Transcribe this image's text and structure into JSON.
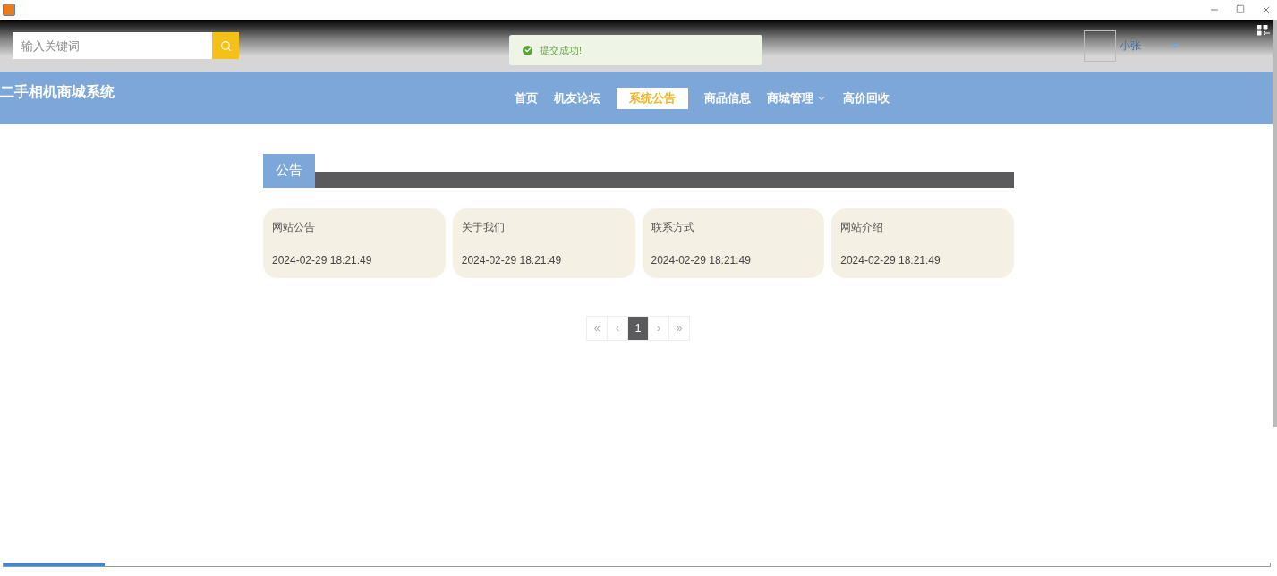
{
  "search": {
    "placeholder": "输入关键词"
  },
  "toast": {
    "message": "提交成功!"
  },
  "user": {
    "name": "小张"
  },
  "site_title": "二手相机商城系统",
  "nav": [
    {
      "label": "首页",
      "selected": false,
      "dropdown": false
    },
    {
      "label": "机友论坛",
      "selected": false,
      "dropdown": false
    },
    {
      "label": "系统公告",
      "selected": true,
      "dropdown": false
    },
    {
      "label": "商品信息",
      "selected": false,
      "dropdown": false
    },
    {
      "label": "商城管理",
      "selected": false,
      "dropdown": true
    },
    {
      "label": "高价回收",
      "selected": false,
      "dropdown": false
    }
  ],
  "section": {
    "title": "公告"
  },
  "notices": [
    {
      "title": "网站公告",
      "time": "2024-02-29 18:21:49"
    },
    {
      "title": "关于我们",
      "time": "2024-02-29 18:21:49"
    },
    {
      "title": "联系方式",
      "time": "2024-02-29 18:21:49"
    },
    {
      "title": "网站介绍",
      "time": "2024-02-29 18:21:49"
    }
  ],
  "pagination": [
    {
      "label": "«",
      "selected": false
    },
    {
      "label": "‹",
      "selected": false
    },
    {
      "label": "1",
      "selected": true
    },
    {
      "label": "›",
      "selected": false
    },
    {
      "label": "»",
      "selected": false
    }
  ],
  "playback": {
    "level": 0.08
  }
}
